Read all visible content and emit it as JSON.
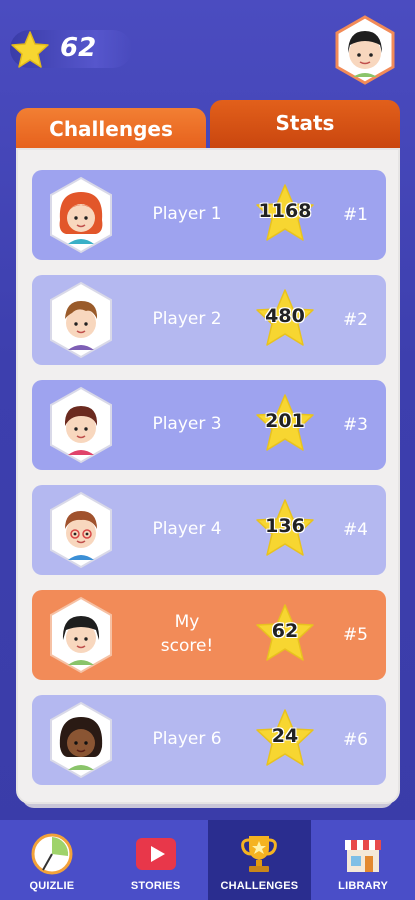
{
  "header": {
    "score": "62"
  },
  "tabs": [
    {
      "label": "Challenges"
    },
    {
      "label": "Stats"
    }
  ],
  "leaderboard": [
    {
      "name": "Player 1",
      "score": "1168",
      "rank": "#1",
      "style": "a"
    },
    {
      "name": "Player 2",
      "score": "480",
      "rank": "#2",
      "style": "b"
    },
    {
      "name": "Player 3",
      "score": "201",
      "rank": "#3",
      "style": "a"
    },
    {
      "name": "Player 4",
      "score": "136",
      "rank": "#4",
      "style": "b"
    },
    {
      "name": "My score!",
      "score": "62",
      "rank": "#5",
      "style": "me"
    },
    {
      "name": "Player 6",
      "score": "24",
      "rank": "#6",
      "style": "b"
    }
  ],
  "nav": [
    {
      "label": "QUIZLIE",
      "icon": "clock-icon"
    },
    {
      "label": "STORIES",
      "icon": "play-icon"
    },
    {
      "label": "CHALLENGES",
      "icon": "trophy-icon"
    },
    {
      "label": "LIBRARY",
      "icon": "store-icon"
    }
  ],
  "colors": {
    "background": "#4b4cc0",
    "tab_orange": "#e6601c",
    "row_blue": "#9ea3ef",
    "row_light": "#b4b8f0",
    "row_me": "#f28b58",
    "star_yellow": "#f7d631"
  }
}
